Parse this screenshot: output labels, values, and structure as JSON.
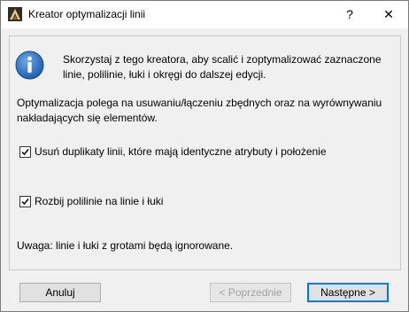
{
  "window": {
    "title": "Kreator optymalizacji linii",
    "help_glyph": "?",
    "close_glyph": "✕"
  },
  "content": {
    "info_text": "Skorzystaj z tego kreatora, aby scalić i zoptymalizować zaznaczone linie, polilinie, łuki i okręgi do dalszej edycji.",
    "description": "Optymalizacja polega na usuwaniu/łączeniu zbędnych oraz na wyrównywaniu nakładających się elementów.",
    "options": [
      {
        "label": "Usuń duplikaty linii, które mają identyczne atrybuty i położenie",
        "checked": true
      },
      {
        "label": "Rozbij polilinie na linie i łuki",
        "checked": true
      }
    ],
    "note": "Uwaga: linie i łuki z grotami będą ignorowane."
  },
  "buttons": {
    "cancel": "Anuluj",
    "previous": "< Poprzednie",
    "next": "Następne >"
  },
  "icons": {
    "app": "archicad-icon",
    "info": "info-icon",
    "check": "checkmark-icon"
  },
  "colors": {
    "accent": "#0078d7",
    "info_blue": "#1e5fae"
  }
}
